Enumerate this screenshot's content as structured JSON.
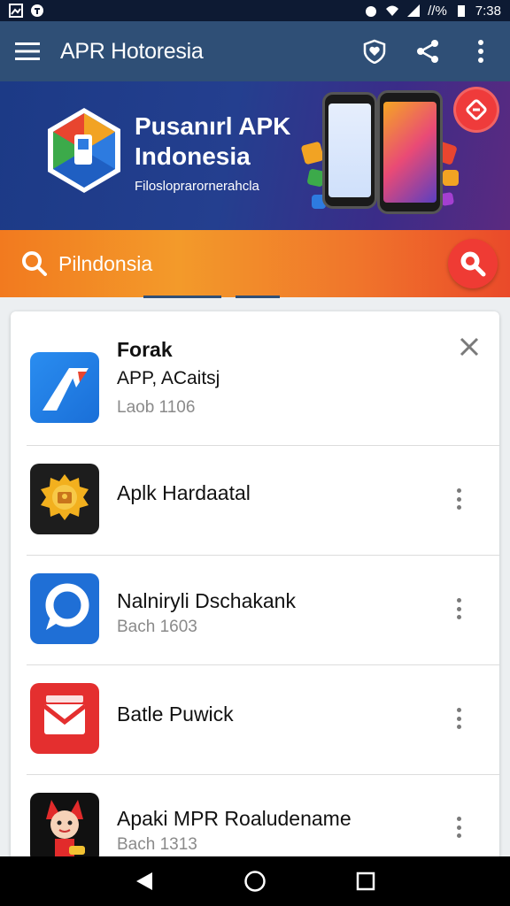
{
  "status_bar": {
    "battery_text": "//%",
    "time": "7:38"
  },
  "app_bar": {
    "title": "APR Hotoresia"
  },
  "banner": {
    "title": "Pusanırl APK Indonesia",
    "subtitle": "Filosloprarornerahcla"
  },
  "search": {
    "value": "Pilndonsia"
  },
  "apps": [
    {
      "title": "Forak",
      "subtitle": "APP, ACaitsj",
      "meta": "Laob 1106",
      "action": "close"
    },
    {
      "title": "Aplk Hardaatal",
      "subtitle": "",
      "meta": "",
      "action": "more"
    },
    {
      "title": "Nalniryli Dschakank",
      "subtitle": "",
      "meta": "Bach 1603",
      "action": "more"
    },
    {
      "title": "Batle Puwick",
      "subtitle": "",
      "meta": "",
      "action": "more"
    },
    {
      "title": "Apaki MPR Roaludename",
      "subtitle": "",
      "meta": "Bach 1313",
      "action": "more"
    }
  ],
  "icons": {
    "menu": "menu-icon",
    "favorite": "heart-shield-icon",
    "share": "share-icon",
    "overflow": "more-vert-icon",
    "search": "search-icon",
    "close": "close-icon",
    "back": "back-triangle-icon",
    "home": "home-circle-icon",
    "recents": "recents-square-icon"
  },
  "colors": {
    "app_bar": "#2f4f76",
    "search_gradient_start": "#f27a1f",
    "search_gradient_end": "#ea4a2a",
    "accent_red": "#ef3b34"
  }
}
